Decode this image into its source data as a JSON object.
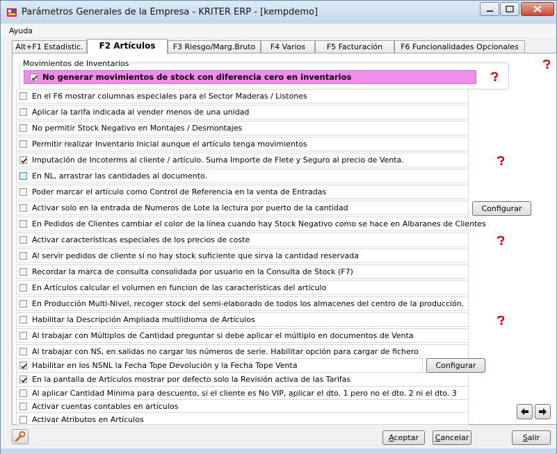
{
  "window": {
    "title": "Parámetros Generales de la Empresa - KRITER ERP - [kempdemo]"
  },
  "menu": {
    "help": "Ayuda"
  },
  "tabs": [
    {
      "label": "Alt+F1 Estadístic."
    },
    {
      "label": "F2 Artículos"
    },
    {
      "label": "F3 Riesgo/Marg.Bruto"
    },
    {
      "label": "F4 Varios"
    },
    {
      "label": "F5 Facturación"
    },
    {
      "label": "F6 Funcionalidades Opcionales"
    }
  ],
  "inventory_group": {
    "label": "Movimientos de Inventarios",
    "option": {
      "label": "No generar movimientos de stock con diferencia cero en inventarios",
      "checked": true
    }
  },
  "options": [
    {
      "label": "En el F6 mostrar columnas especiales para el Sector Maderas / Listones",
      "checked": false
    },
    {
      "label": "Aplicar la tarifa indicada al vender menos de una unidad",
      "checked": false
    },
    {
      "label": "No permitir Stock Negativo en Montajes / Desmontajes",
      "checked": false
    },
    {
      "label": "Permitir realizar Inventario Inicial aunque el artículo tenga movimientos",
      "checked": false
    },
    {
      "label": "Imputación de Incoterms al cliente / artículo.  Suma Importe de Flete y Seguro al precio de Venta.",
      "checked": true
    },
    {
      "label": "En NL, arrastrar las cantidades al documento.",
      "checked": false
    },
    {
      "label": "Poder marcar el artículo como Control de Referencia en la venta de Entradas",
      "checked": false
    },
    {
      "label": "Activar solo en la entrada de Numeros de Lote la lectura por puerto de la cantidad",
      "checked": false
    },
    {
      "label": "En Pedidos de Clientes cambiar el color de la línea cuando hay Stock Negativo como se hace en Albaranes de Clientes",
      "checked": false
    },
    {
      "label": "Activar características especiales de los precios de coste",
      "checked": false
    },
    {
      "label": "Al servir pedidos de cliente si no hay stock suficiente que sirva la cantidad reservada",
      "checked": false
    },
    {
      "label": "Recordar la marca de consulta consolidada por usuario en la Consulta de Stock (F7)",
      "checked": false
    },
    {
      "label": "En Artículos calcular el volumen en funcion de las características del artículo",
      "checked": false
    },
    {
      "label": "En Producción Multi-Nivel, recoger stock del semi-elaborado de todos los almacenes del centro de la producción.",
      "checked": false
    },
    {
      "label": "Habilitar la Descripción Ampliada multiidioma de Artículos",
      "checked": false
    },
    {
      "label": "Al trabajar con Múltiplos de Cantidad preguntar si debe aplicar el múltiplo en documentos de Venta",
      "checked": false
    },
    {
      "label": "Al trabajar con NS, en salidas no cargar los números de serie. Habilitar opción para cargar de fichero",
      "checked": false
    },
    {
      "label": "Habilitar en los NSNL la Fecha Tope Devolución y la Fecha Tope Venta",
      "checked": true
    },
    {
      "label": "En la pantalla de Artículos mostrar por defecto solo la Revisión activa de las Tarifas",
      "checked": true
    },
    {
      "label": "Al aplicar Cantidad Mínima para descuento, si el cliente es No VIP, aplicar el dto. 1 pero no el dto. 2 ni el dto. 3",
      "checked": false
    },
    {
      "label": "Activar cuentas contables en artículos",
      "checked": false
    },
    {
      "label": "Activar Atributos en Artículos",
      "checked": false
    }
  ],
  "buttons": {
    "configure": "Configurar",
    "accept_pre": "",
    "accept_ul": "A",
    "accept_post": "ceptar",
    "cancel_pre": "",
    "cancel_ul": "C",
    "cancel_post": "ancelar",
    "exit_pre": "",
    "exit_ul": "S",
    "exit_post": "alir"
  },
  "icons": {
    "help": "help-question-icon",
    "left": "arrow-left-icon",
    "right": "arrow-right-icon",
    "tools": "wrench-icon"
  }
}
